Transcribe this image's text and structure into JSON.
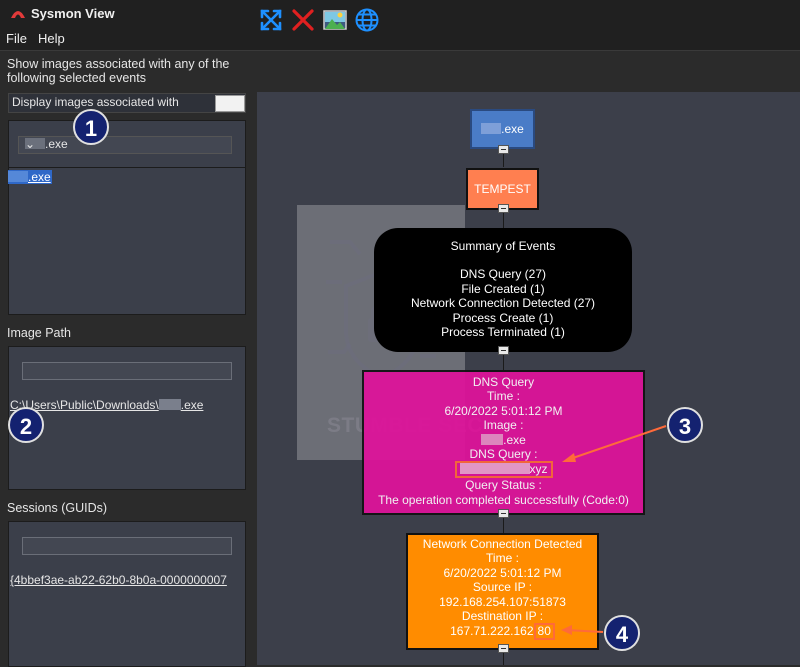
{
  "window": {
    "title": "Sysmon View"
  },
  "menu": [
    "File",
    "Help"
  ],
  "sidebar": {
    "filter_heading_line1": "Show images associated with any of the",
    "filter_heading_line2": "following selected events",
    "display_images_label": "Display images associated with",
    "combo_value": ".exe",
    "selected_executable": ".exe",
    "image_path_label": "Image Path",
    "image_path_prefix": "C:\\Users\\Public\\Downloads\\",
    "image_path_suffix": ".exe",
    "sessions_label": "Sessions (GUIDs)",
    "session_guid": "{4bbef3ae-ab22-62b0-8b0a-0000000007"
  },
  "badges": [
    "1",
    "2",
    "3",
    "4"
  ],
  "toolbar": {
    "icons": [
      "expand-arrows-icon",
      "delete-x-icon",
      "image-icon",
      "globe-icon"
    ],
    "colors": {
      "expand": "#1e90ff",
      "delete": "#e02020",
      "globe": "#1e90ff"
    }
  },
  "watermark": {
    "text": "STUMBLE SEC"
  },
  "graph": {
    "root_exe": ".exe",
    "process_node": "TEMPEST",
    "summary": {
      "title": "Summary of Events",
      "lines": [
        "DNS Query (27)",
        "File Created (1)",
        "Network Connection Detected (27)",
        "Process Create (1)",
        "Process Terminated (1)"
      ]
    },
    "dns": {
      "title": "DNS Query",
      "time_label": "Time :",
      "time": "6/20/2022 5:01:12 PM",
      "image_label": "Image :",
      "image": ".exe",
      "query_label": "DNS Query :",
      "query_suffix": "xyz",
      "status_label": "Query Status :",
      "status": "The operation completed successfully (Code:0)"
    },
    "net": {
      "title": "Network Connection Detected",
      "time_label": "Time :",
      "time": "6/20/2022 5:01:12 PM",
      "src_label": "Source IP :",
      "src": "192.168.254.107:51873",
      "dst_label": "Destination IP :",
      "dst": "167.71.222.162",
      "dst_port": "80"
    },
    "colors": {
      "root": "#4a7cc7",
      "process": "#ff7f50",
      "summary": "#000000",
      "dns": "#e0129b",
      "net": "#ff8c00",
      "highlight": "#ff6a3a"
    }
  }
}
